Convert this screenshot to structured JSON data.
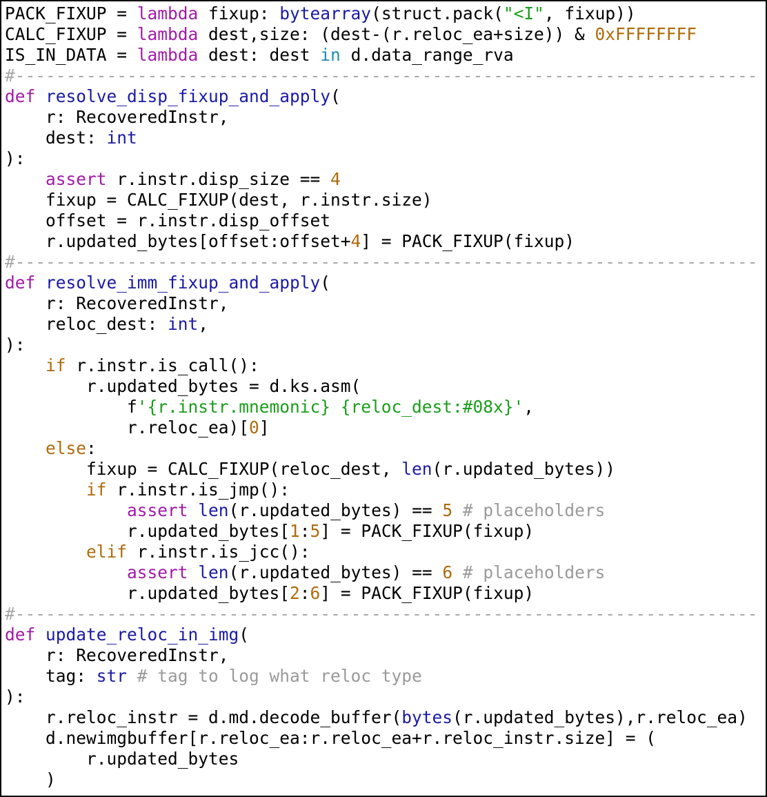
{
  "colors": {
    "background": "#ffffff",
    "border": "#000000",
    "plain": "#000000",
    "keyword": "#a21aa8",
    "function_name": "#1a1aa6",
    "builtin": "#1a1aa6",
    "in_operator": "#1a8fb0",
    "string": "#1a9e1a",
    "number": "#b06a0b",
    "control_flow": "#b06a0b",
    "comment": "#9a9a9a"
  },
  "code_lines": [
    [
      [
        "plain",
        "PACK_FIXUP = "
      ],
      [
        "kw",
        "lambda"
      ],
      [
        "plain",
        " fixup: "
      ],
      [
        "builtin",
        "bytearray"
      ],
      [
        "plain",
        "(struct.pack("
      ],
      [
        "str",
        "\"<I\""
      ],
      [
        "plain",
        ", fixup))"
      ]
    ],
    [
      [
        "plain",
        "CALC_FIXUP = "
      ],
      [
        "kw",
        "lambda"
      ],
      [
        "plain",
        " dest,size: (dest-(r.reloc_ea+size)) & "
      ],
      [
        "num",
        "0xFFFFFFFF"
      ]
    ],
    [
      [
        "plain",
        "IS_IN_DATA = "
      ],
      [
        "kw",
        "lambda"
      ],
      [
        "plain",
        " dest: dest "
      ],
      [
        "in",
        "in"
      ],
      [
        "plain",
        " d.data_range_rva"
      ]
    ],
    [
      [
        "sep",
        "#-------------------------------------------------------------------------"
      ]
    ],
    [
      [
        "def",
        "def"
      ],
      [
        "plain",
        " "
      ],
      [
        "fn",
        "resolve_disp_fixup_and_apply"
      ],
      [
        "plain",
        "("
      ]
    ],
    [
      [
        "plain",
        "    r: RecoveredInstr,"
      ]
    ],
    [
      [
        "plain",
        "    dest: "
      ],
      [
        "type",
        "int"
      ]
    ],
    [
      [
        "plain",
        "):"
      ]
    ],
    [
      [
        "plain",
        "    "
      ],
      [
        "kw",
        "assert"
      ],
      [
        "plain",
        " r.instr.disp_size == "
      ],
      [
        "num",
        "4"
      ]
    ],
    [
      [
        "plain",
        "    fixup = CALC_FIXUP(dest, r.instr.size)"
      ]
    ],
    [
      [
        "plain",
        "    offset = r.instr.disp_offset"
      ]
    ],
    [
      [
        "plain",
        "    r.updated_bytes[offset:offset+"
      ],
      [
        "num",
        "4"
      ],
      [
        "plain",
        "] = PACK_FIXUP(fixup)"
      ]
    ],
    [
      [
        "sep",
        "#-------------------------------------------------------------------------"
      ]
    ],
    [
      [
        "def",
        "def"
      ],
      [
        "plain",
        " "
      ],
      [
        "fn",
        "resolve_imm_fixup_and_apply"
      ],
      [
        "plain",
        "("
      ]
    ],
    [
      [
        "plain",
        "    r: RecoveredInstr,"
      ]
    ],
    [
      [
        "plain",
        "    reloc_dest: "
      ],
      [
        "type",
        "int"
      ],
      [
        "plain",
        ","
      ]
    ],
    [
      [
        "plain",
        "):"
      ]
    ],
    [
      [
        "plain",
        "    "
      ],
      [
        "flow",
        "if"
      ],
      [
        "plain",
        " r.instr.is_call():"
      ]
    ],
    [
      [
        "plain",
        "        r.updated_bytes = d.ks.asm("
      ]
    ],
    [
      [
        "plain",
        "            f"
      ],
      [
        "str",
        "'{r.instr.mnemonic} {reloc_dest:#08x}'"
      ],
      [
        "plain",
        ","
      ]
    ],
    [
      [
        "plain",
        "            r.reloc_ea)["
      ],
      [
        "num",
        "0"
      ],
      [
        "plain",
        "]"
      ]
    ],
    [
      [
        "plain",
        "    "
      ],
      [
        "flow",
        "else"
      ],
      [
        "plain",
        ":"
      ]
    ],
    [
      [
        "plain",
        "        fixup = CALC_FIXUP(reloc_dest, "
      ],
      [
        "builtin",
        "len"
      ],
      [
        "plain",
        "(r.updated_bytes))"
      ]
    ],
    [
      [
        "plain",
        "        "
      ],
      [
        "flow",
        "if"
      ],
      [
        "plain",
        " r.instr.is_jmp():"
      ]
    ],
    [
      [
        "plain",
        "            "
      ],
      [
        "kw",
        "assert"
      ],
      [
        "plain",
        " "
      ],
      [
        "builtin",
        "len"
      ],
      [
        "plain",
        "(r.updated_bytes) == "
      ],
      [
        "num",
        "5"
      ],
      [
        "plain",
        " "
      ],
      [
        "comment",
        "# placeholders"
      ]
    ],
    [
      [
        "plain",
        "            r.updated_bytes["
      ],
      [
        "num",
        "1"
      ],
      [
        "plain",
        ":"
      ],
      [
        "num",
        "5"
      ],
      [
        "plain",
        "] = PACK_FIXUP(fixup)"
      ]
    ],
    [
      [
        "plain",
        "        "
      ],
      [
        "flow",
        "elif"
      ],
      [
        "plain",
        " r.instr.is_jcc():"
      ]
    ],
    [
      [
        "plain",
        "            "
      ],
      [
        "kw",
        "assert"
      ],
      [
        "plain",
        " "
      ],
      [
        "builtin",
        "len"
      ],
      [
        "plain",
        "(r.updated_bytes) == "
      ],
      [
        "num",
        "6"
      ],
      [
        "plain",
        " "
      ],
      [
        "comment",
        "# placeholders"
      ]
    ],
    [
      [
        "plain",
        "            r.updated_bytes["
      ],
      [
        "num",
        "2"
      ],
      [
        "plain",
        ":"
      ],
      [
        "num",
        "6"
      ],
      [
        "plain",
        "] = PACK_FIXUP(fixup)"
      ]
    ],
    [
      [
        "sep",
        "#-------------------------------------------------------------------------"
      ]
    ],
    [
      [
        "def",
        "def"
      ],
      [
        "plain",
        " "
      ],
      [
        "fn",
        "update_reloc_in_img"
      ],
      [
        "plain",
        "("
      ]
    ],
    [
      [
        "plain",
        "    r: RecoveredInstr,"
      ]
    ],
    [
      [
        "plain",
        "    tag: "
      ],
      [
        "type",
        "str"
      ],
      [
        "plain",
        " "
      ],
      [
        "comment",
        "# tag to log what reloc type"
      ]
    ],
    [
      [
        "plain",
        "):"
      ]
    ],
    [
      [
        "plain",
        "    r.reloc_instr = d.md.decode_buffer("
      ],
      [
        "builtin",
        "bytes"
      ],
      [
        "plain",
        "(r.updated_bytes),r.reloc_ea)"
      ]
    ],
    [
      [
        "plain",
        "    d.newimgbuffer[r.reloc_ea:r.reloc_ea+r.reloc_instr.size] = ("
      ]
    ],
    [
      [
        "plain",
        "        r.updated_bytes"
      ]
    ],
    [
      [
        "plain",
        "    )"
      ]
    ]
  ]
}
